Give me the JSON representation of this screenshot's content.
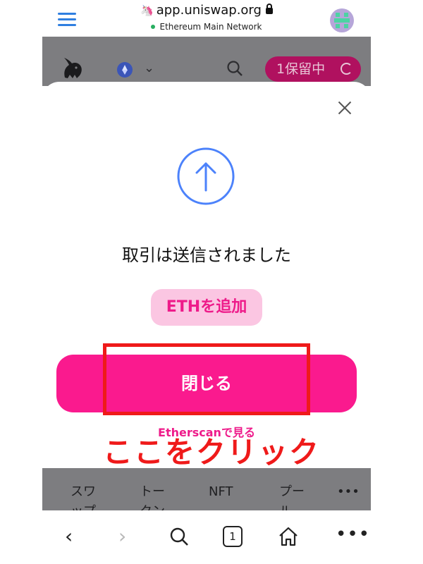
{
  "browser": {
    "url": "app.uniswap.org",
    "network": "Ethereum Main Network",
    "tab_count": "1"
  },
  "dapp": {
    "pending_label": "1保留中",
    "nav": [
      "スワップ",
      "トークン",
      "NFT",
      "プール",
      "•••"
    ]
  },
  "modal": {
    "title": "取引は送信されました",
    "add_token_label": "ETHを追加",
    "close_label": "閉じる",
    "etherscan_label": "Etherscanで見る"
  },
  "annotation": {
    "text": "ここをクリック",
    "color": "#ef1a1a"
  },
  "colors": {
    "accent_pink": "#fa1a8e",
    "hamburger_blue": "#2f7fe0",
    "arrow_blue": "#4c82fb"
  },
  "icons": [
    "menu-icon",
    "lock-icon",
    "unicorn-logo-icon",
    "ethereum-icon",
    "chevron-down-icon",
    "search-icon",
    "spinner-icon",
    "close-icon",
    "arrow-up-circle-icon",
    "back-icon",
    "forward-icon",
    "tabs-icon",
    "home-icon",
    "more-icon"
  ]
}
